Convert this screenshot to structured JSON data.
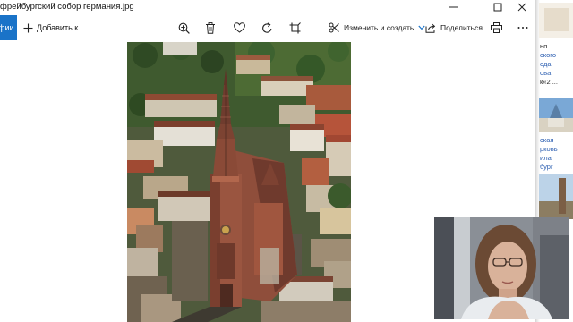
{
  "window": {
    "title": "фрейбургский собор германия.jpg"
  },
  "toolbar": {
    "album_tab_label": "фии",
    "add_label": "Добавить к",
    "edit_create_label": "Изменить и создать",
    "share_label": "Поделиться",
    "icons": [
      "zoom-in-icon",
      "delete-icon",
      "heart-icon",
      "rotate-icon",
      "crop-icon",
      "print-icon",
      "more-icon"
    ]
  },
  "background_window": {
    "text_lines_1": [
      "ня",
      "ского",
      "ода",
      "ова",
      "к«2 ..."
    ],
    "text_lines_2": [
      "ская",
      "рковь",
      "ила",
      "бург"
    ]
  },
  "colors": {
    "accent": "#1a73c8",
    "link": "#2a5db0"
  }
}
